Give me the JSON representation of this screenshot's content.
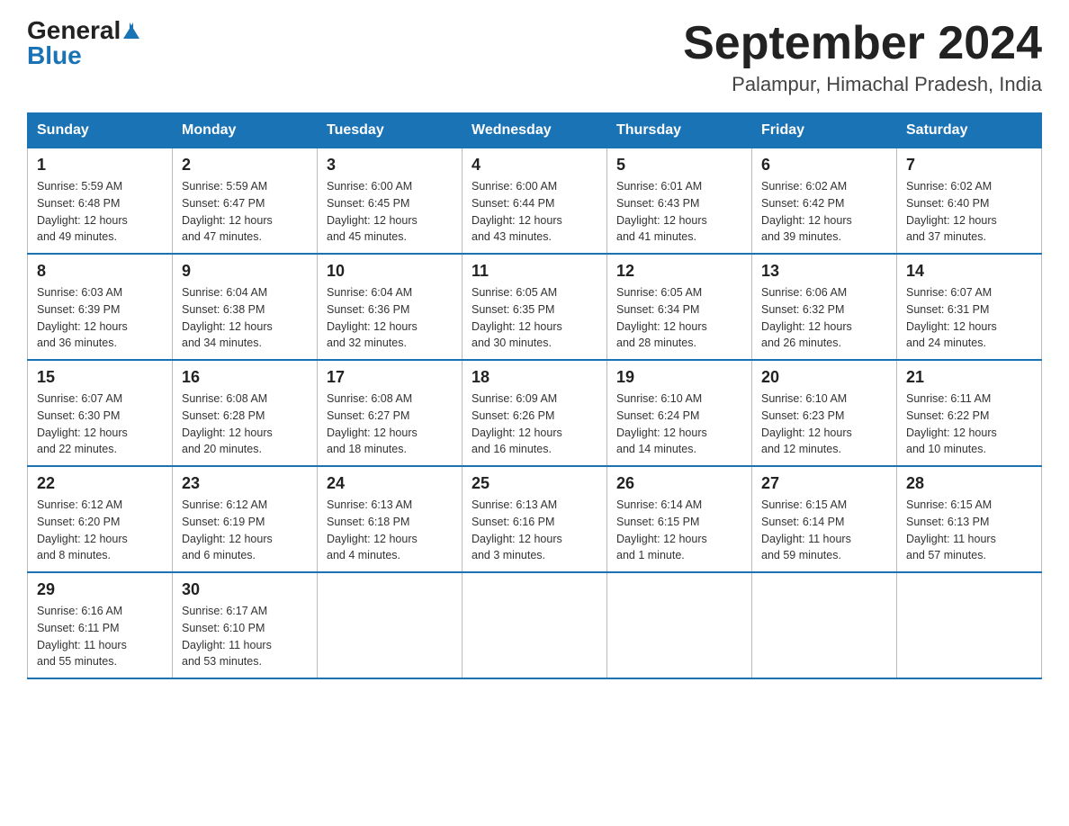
{
  "header": {
    "logo_general": "General",
    "logo_blue": "Blue",
    "month_title": "September 2024",
    "location": "Palampur, Himachal Pradesh, India"
  },
  "weekdays": [
    "Sunday",
    "Monday",
    "Tuesday",
    "Wednesday",
    "Thursday",
    "Friday",
    "Saturday"
  ],
  "weeks": [
    [
      {
        "day": "1",
        "sunrise": "5:59 AM",
        "sunset": "6:48 PM",
        "daylight": "12 hours and 49 minutes."
      },
      {
        "day": "2",
        "sunrise": "5:59 AM",
        "sunset": "6:47 PM",
        "daylight": "12 hours and 47 minutes."
      },
      {
        "day": "3",
        "sunrise": "6:00 AM",
        "sunset": "6:45 PM",
        "daylight": "12 hours and 45 minutes."
      },
      {
        "day": "4",
        "sunrise": "6:00 AM",
        "sunset": "6:44 PM",
        "daylight": "12 hours and 43 minutes."
      },
      {
        "day": "5",
        "sunrise": "6:01 AM",
        "sunset": "6:43 PM",
        "daylight": "12 hours and 41 minutes."
      },
      {
        "day": "6",
        "sunrise": "6:02 AM",
        "sunset": "6:42 PM",
        "daylight": "12 hours and 39 minutes."
      },
      {
        "day": "7",
        "sunrise": "6:02 AM",
        "sunset": "6:40 PM",
        "daylight": "12 hours and 37 minutes."
      }
    ],
    [
      {
        "day": "8",
        "sunrise": "6:03 AM",
        "sunset": "6:39 PM",
        "daylight": "12 hours and 36 minutes."
      },
      {
        "day": "9",
        "sunrise": "6:04 AM",
        "sunset": "6:38 PM",
        "daylight": "12 hours and 34 minutes."
      },
      {
        "day": "10",
        "sunrise": "6:04 AM",
        "sunset": "6:36 PM",
        "daylight": "12 hours and 32 minutes."
      },
      {
        "day": "11",
        "sunrise": "6:05 AM",
        "sunset": "6:35 PM",
        "daylight": "12 hours and 30 minutes."
      },
      {
        "day": "12",
        "sunrise": "6:05 AM",
        "sunset": "6:34 PM",
        "daylight": "12 hours and 28 minutes."
      },
      {
        "day": "13",
        "sunrise": "6:06 AM",
        "sunset": "6:32 PM",
        "daylight": "12 hours and 26 minutes."
      },
      {
        "day": "14",
        "sunrise": "6:07 AM",
        "sunset": "6:31 PM",
        "daylight": "12 hours and 24 minutes."
      }
    ],
    [
      {
        "day": "15",
        "sunrise": "6:07 AM",
        "sunset": "6:30 PM",
        "daylight": "12 hours and 22 minutes."
      },
      {
        "day": "16",
        "sunrise": "6:08 AM",
        "sunset": "6:28 PM",
        "daylight": "12 hours and 20 minutes."
      },
      {
        "day": "17",
        "sunrise": "6:08 AM",
        "sunset": "6:27 PM",
        "daylight": "12 hours and 18 minutes."
      },
      {
        "day": "18",
        "sunrise": "6:09 AM",
        "sunset": "6:26 PM",
        "daylight": "12 hours and 16 minutes."
      },
      {
        "day": "19",
        "sunrise": "6:10 AM",
        "sunset": "6:24 PM",
        "daylight": "12 hours and 14 minutes."
      },
      {
        "day": "20",
        "sunrise": "6:10 AM",
        "sunset": "6:23 PM",
        "daylight": "12 hours and 12 minutes."
      },
      {
        "day": "21",
        "sunrise": "6:11 AM",
        "sunset": "6:22 PM",
        "daylight": "12 hours and 10 minutes."
      }
    ],
    [
      {
        "day": "22",
        "sunrise": "6:12 AM",
        "sunset": "6:20 PM",
        "daylight": "12 hours and 8 minutes."
      },
      {
        "day": "23",
        "sunrise": "6:12 AM",
        "sunset": "6:19 PM",
        "daylight": "12 hours and 6 minutes."
      },
      {
        "day": "24",
        "sunrise": "6:13 AM",
        "sunset": "6:18 PM",
        "daylight": "12 hours and 4 minutes."
      },
      {
        "day": "25",
        "sunrise": "6:13 AM",
        "sunset": "6:16 PM",
        "daylight": "12 hours and 3 minutes."
      },
      {
        "day": "26",
        "sunrise": "6:14 AM",
        "sunset": "6:15 PM",
        "daylight": "12 hours and 1 minute."
      },
      {
        "day": "27",
        "sunrise": "6:15 AM",
        "sunset": "6:14 PM",
        "daylight": "11 hours and 59 minutes."
      },
      {
        "day": "28",
        "sunrise": "6:15 AM",
        "sunset": "6:13 PM",
        "daylight": "11 hours and 57 minutes."
      }
    ],
    [
      {
        "day": "29",
        "sunrise": "6:16 AM",
        "sunset": "6:11 PM",
        "daylight": "11 hours and 55 minutes."
      },
      {
        "day": "30",
        "sunrise": "6:17 AM",
        "sunset": "6:10 PM",
        "daylight": "11 hours and 53 minutes."
      },
      null,
      null,
      null,
      null,
      null
    ]
  ],
  "labels": {
    "sunrise": "Sunrise:",
    "sunset": "Sunset:",
    "daylight": "Daylight:"
  }
}
